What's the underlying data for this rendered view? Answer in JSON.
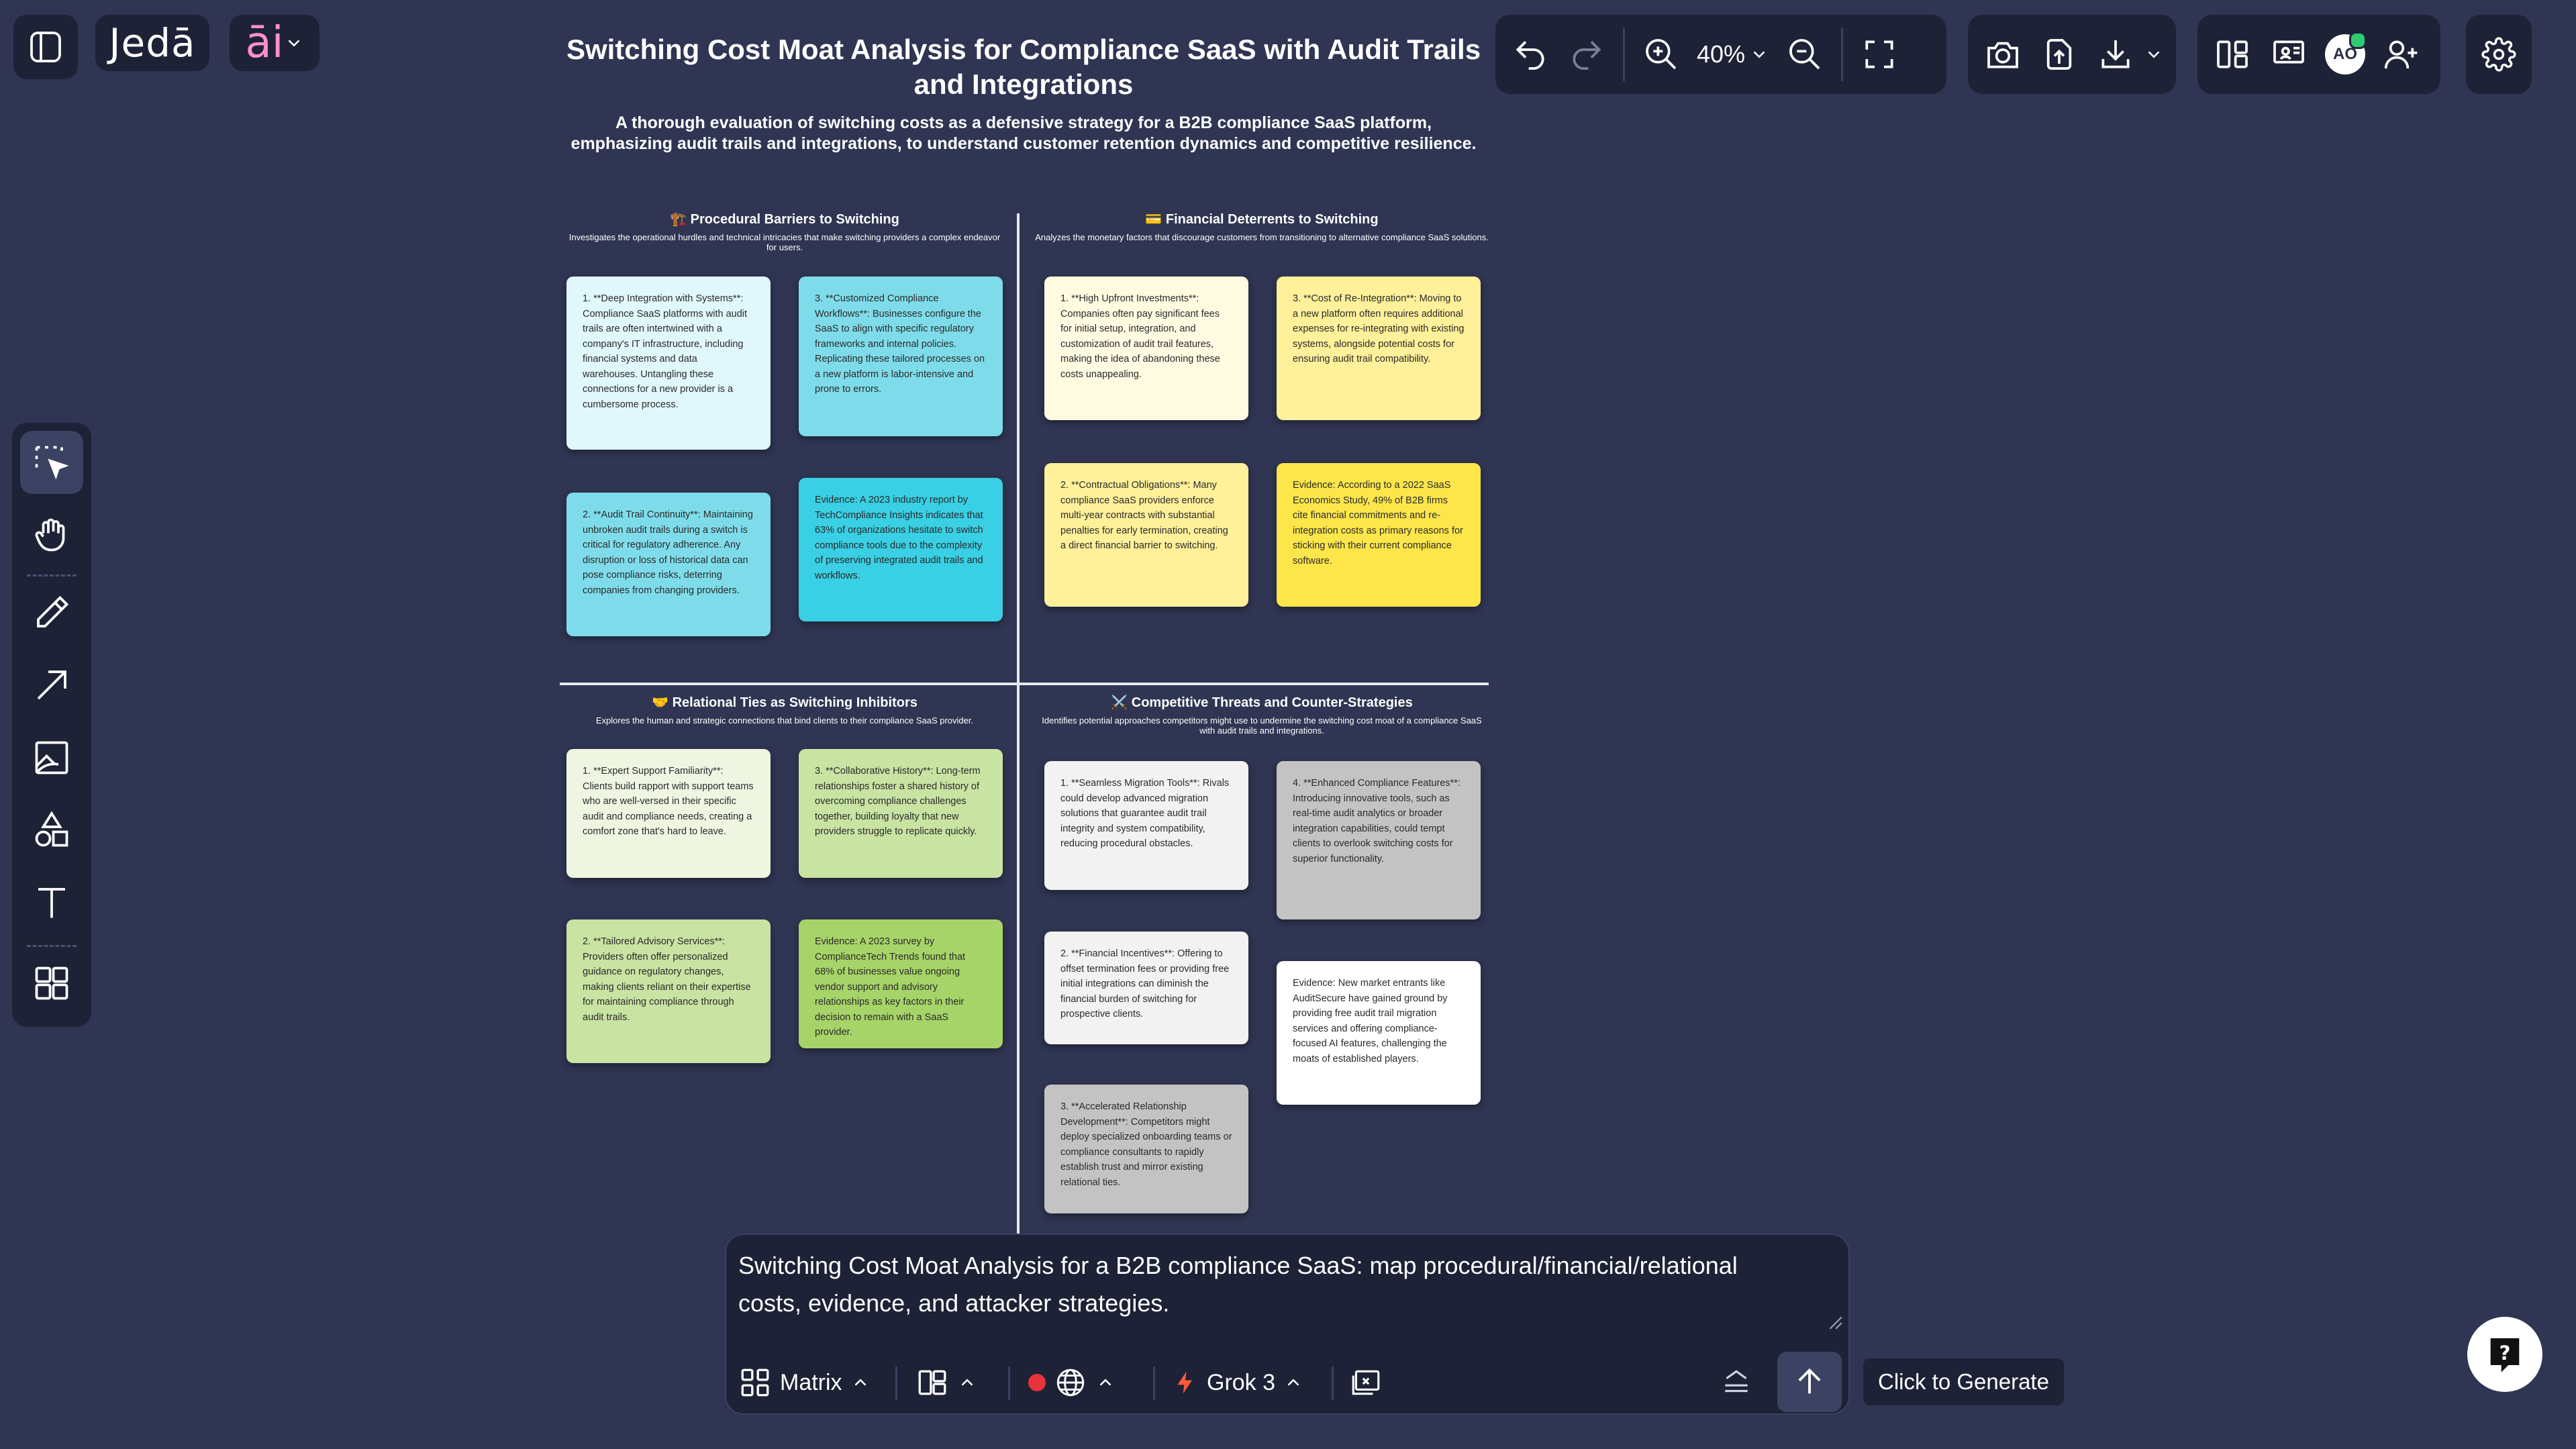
{
  "app": {
    "brand": "Jedā",
    "ai_brand": "āi"
  },
  "toolbar": {
    "zoom": "40%",
    "avatar_initials": "AO"
  },
  "canvas": {
    "title": "Switching Cost Moat Analysis for Compliance SaaS with Audit Trails and Integrations",
    "subtitle": "A thorough evaluation of switching costs as a defensive strategy for a B2B compliance SaaS platform, emphasizing audit trails and integrations, to understand customer retention dynamics and competitive resilience.",
    "quadrants": [
      {
        "icon": "🏗️",
        "title": "Procedural Barriers to Switching",
        "desc": "Investigates the operational hurdles and technical intricacies that make switching providers a complex endeavor for users.",
        "cards": [
          "1. **Deep Integration with Systems**: Compliance SaaS platforms with audit trails are often intertwined with a company's IT infrastructure, including financial systems and data warehouses. Untangling these connections for a new provider is a cumbersome process.",
          "3. **Customized Compliance Workflows**: Businesses configure the SaaS to align with specific regulatory frameworks and internal policies. Replicating these tailored processes on a new platform is labor-intensive and prone to errors.",
          "2. **Audit Trail Continuity**: Maintaining unbroken audit trails during a switch is critical for regulatory adherence. Any disruption or loss of historical data can pose compliance risks, deterring companies from changing providers.",
          "Evidence: A 2023 industry report by TechCompliance Insights indicates that 63% of organizations hesitate to switch compliance tools due to the complexity of preserving integrated audit trails and workflows."
        ]
      },
      {
        "icon": "💳",
        "title": "Financial Deterrents to Switching",
        "desc": "Analyzes the monetary factors that discourage customers from transitioning to alternative compliance SaaS solutions.",
        "cards": [
          "1. **High Upfront Investments**: Companies often pay significant fees for initial setup, integration, and customization of audit trail features, making the idea of abandoning these costs unappealing.",
          "3. **Cost of Re-Integration**: Moving to a new platform often requires additional expenses for re-integrating with existing systems, alongside potential costs for ensuring audit trail compatibility.",
          "2. **Contractual Obligations**: Many compliance SaaS providers enforce multi-year contracts with substantial penalties for early termination, creating a direct financial barrier to switching.",
          "Evidence: According to a 2022 SaaS Economics Study, 49% of B2B firms cite financial commitments and re-integration costs as primary reasons for sticking with their current compliance software."
        ]
      },
      {
        "icon": "🤝",
        "title": "Relational Ties as Switching Inhibitors",
        "desc": "Explores the human and strategic connections that bind clients to their compliance SaaS provider.",
        "cards": [
          "1. **Expert Support Familiarity**: Clients build rapport with support teams who are well-versed in their specific audit and compliance needs, creating a comfort zone that's hard to leave.",
          "3. **Collaborative History**: Long-term relationships foster a shared history of overcoming compliance challenges together, building loyalty that new providers struggle to replicate quickly.",
          "2. **Tailored Advisory Services**: Providers often offer personalized guidance on regulatory changes, making clients reliant on their expertise for maintaining compliance through audit trails.",
          "Evidence: A 2023 survey by ComplianceTech Trends found that 68% of businesses value ongoing vendor support and advisory relationships as key factors in their decision to remain with a SaaS provider."
        ]
      },
      {
        "icon": "⚔️",
        "title": "Competitive Threats and Counter-Strategies",
        "desc": "Identifies potential approaches competitors might use to undermine the switching cost moat of a compliance SaaS with audit trails and integrations.",
        "cards": [
          "1. **Seamless Migration Tools**: Rivals could develop advanced migration solutions that guarantee audit trail integrity and system compatibility, reducing procedural obstacles.",
          "4. **Enhanced Compliance Features**: Introducing innovative tools, such as real-time audit analytics or broader integration capabilities, could tempt clients to overlook switching costs for superior functionality.",
          "2. **Financial Incentives**: Offering to offset termination fees or providing free initial integrations can diminish the financial burden of switching for prospective clients.",
          "Evidence: New market entrants like AuditSecure have gained ground by providing free audit trail migration services and offering compliance-focused AI features, challenging the moats of established players.",
          "3. **Accelerated Relationship Development**: Competitors might deploy specialized onboarding teams or compliance consultants to rapidly establish trust and mirror existing relational ties."
        ]
      }
    ]
  },
  "prompt": {
    "text": "Switching Cost Moat Analysis for a B2B compliance SaaS: map procedural/financial/relational costs, evidence, and attacker strategies.",
    "layout_label": "Matrix",
    "model_label": "Grok 3",
    "generate_tooltip": "Click to Generate"
  },
  "icons": {
    "top_left": [
      "sidebar-toggle-icon"
    ],
    "history": [
      "undo-icon",
      "redo-icon"
    ],
    "zoom": [
      "zoom-in-icon",
      "chevron-down-icon",
      "zoom-out-icon",
      "fullscreen-icon"
    ],
    "export": [
      "camera-icon",
      "share-icon",
      "download-icon",
      "chevron-down-icon"
    ],
    "view": [
      "split-view-icon",
      "presentation-icon",
      "avatar",
      "add-user-icon"
    ],
    "settings": [
      "gear-icon"
    ],
    "left_tools": [
      "select-icon",
      "hand-icon",
      "pencil-icon",
      "arrow-icon",
      "image-icon",
      "shapes-icon",
      "text-icon",
      "grid-icon"
    ],
    "prompt_bar": [
      "matrix-icon",
      "layout-icon",
      "record-dot",
      "globe-icon",
      "lightning-icon",
      "chat-screen-icon",
      "stack-icon",
      "arrow-up-icon",
      "help-icon"
    ]
  },
  "colors": {
    "background": "#2f3552",
    "panel": "#1e2236",
    "record_dot": "#e8323c",
    "lightning": "#ff5a36",
    "ai_brand": "#ff8fd0",
    "cyan_light": "#e0f7fb",
    "cyan_mid": "#7edcea",
    "cyan_strong": "#39cfe4",
    "yellow_light": "#fffbe1",
    "yellow_mid": "#fff09a",
    "yellow_strong": "#fde64a",
    "green_light": "#eef6e2",
    "green_mid": "#c8e3a2",
    "green_strong": "#a6d468",
    "gray_light": "#f2f2f2",
    "gray_mid": "#c3c3c3"
  }
}
